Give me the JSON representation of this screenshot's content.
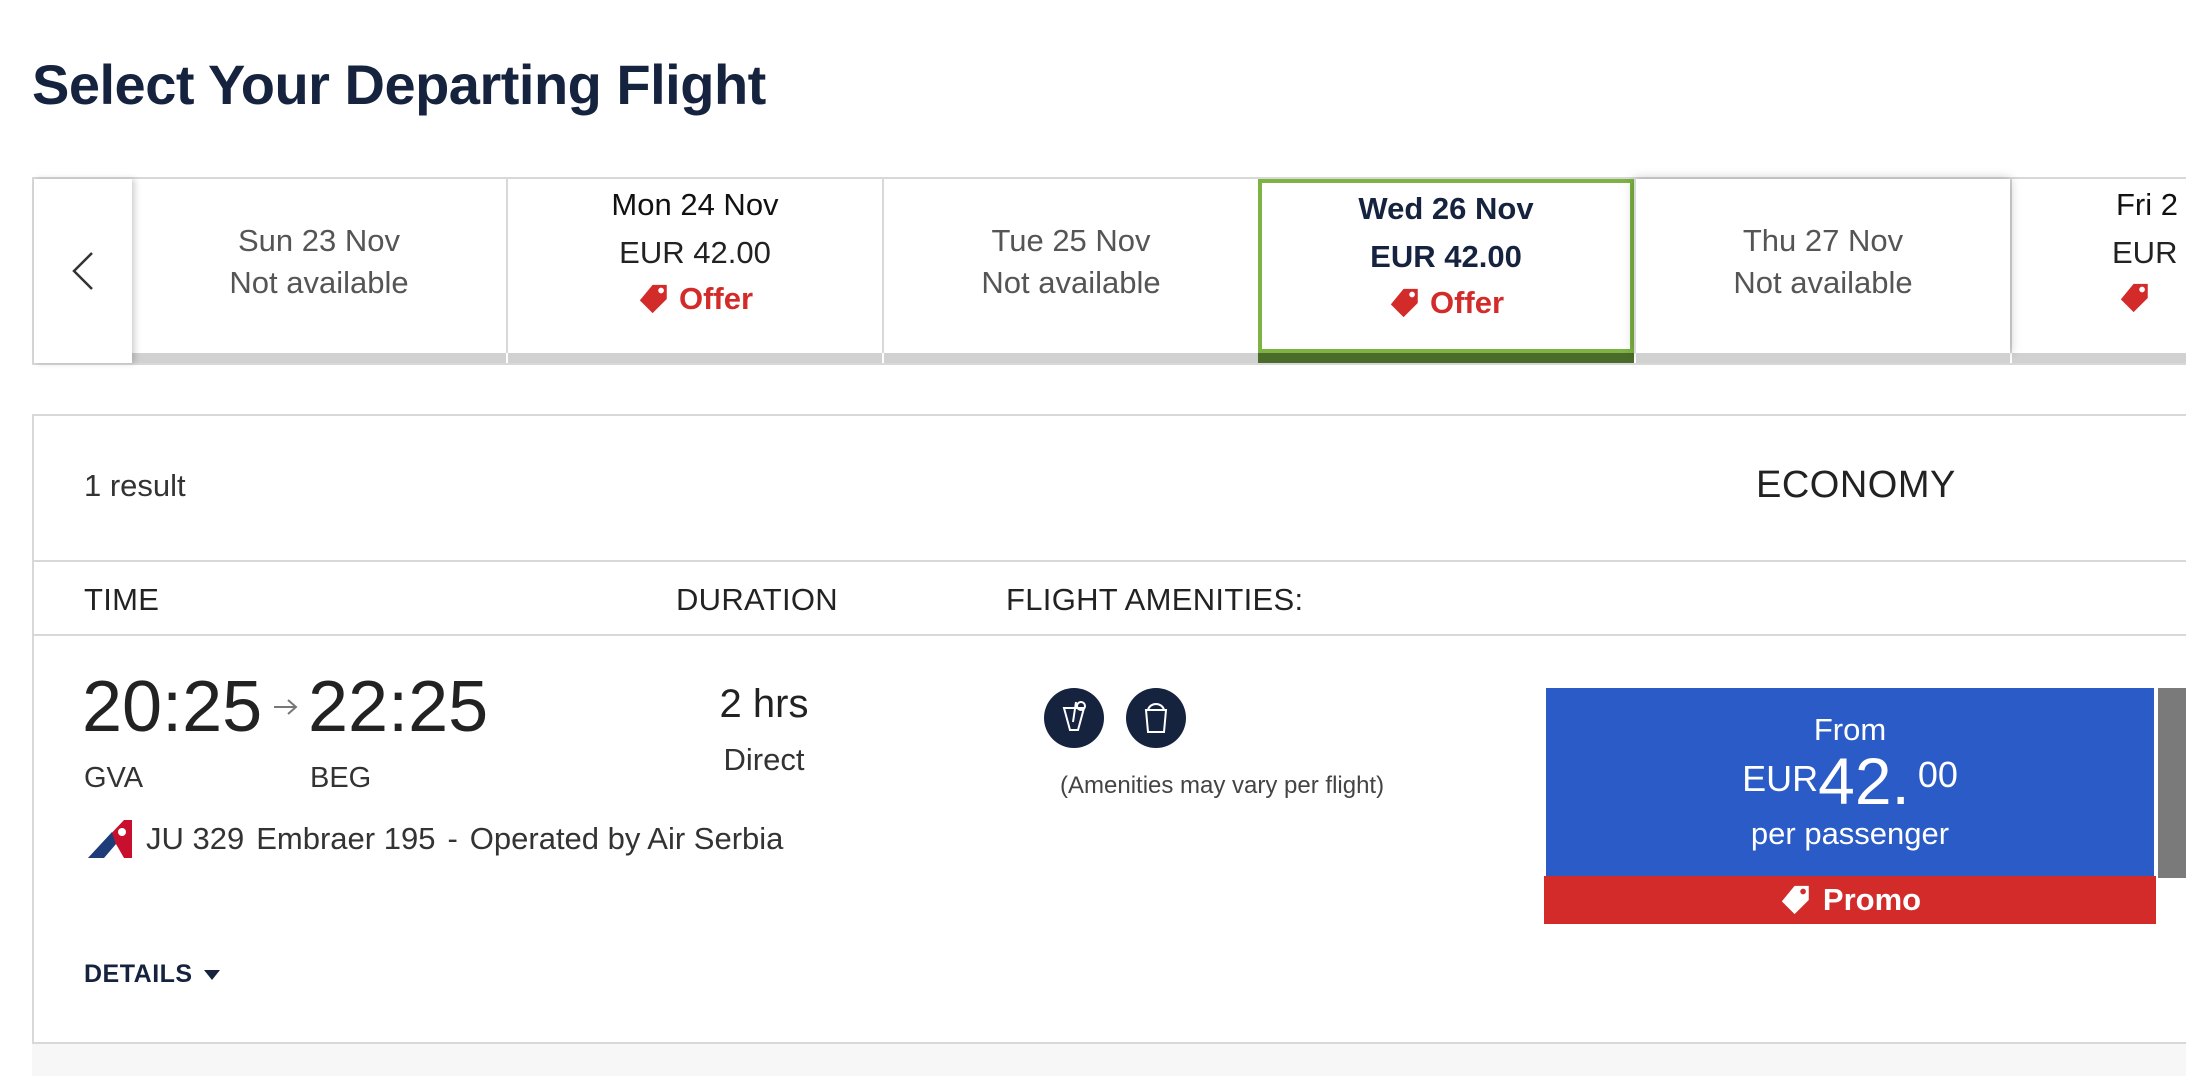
{
  "page": {
    "title": "Select Your Departing Flight"
  },
  "date_strip": {
    "dates": [
      {
        "day": "Sun 23 Nov",
        "status": "Not available"
      },
      {
        "day": "Mon 24 Nov",
        "price": "EUR 42.00",
        "badge": "Offer"
      },
      {
        "day": "Tue 25 Nov",
        "status": "Not available"
      },
      {
        "day": "Wed 26 Nov",
        "price": "EUR 42.00",
        "badge": "Offer",
        "selected": true
      },
      {
        "day": "Thu 27 Nov",
        "status": "Not available"
      },
      {
        "day": "Fri 2",
        "price": "EUR",
        "badge": ""
      }
    ]
  },
  "results": {
    "count_label": "1 result",
    "cabin": "ECONOMY",
    "columns": {
      "time": "TIME",
      "duration": "DURATION",
      "amenities": "FLIGHT AMENITIES:"
    },
    "flight": {
      "depart_time": "20:25",
      "arrive_time": "22:25",
      "origin": "GVA",
      "destination": "BEG",
      "flight_number": "JU 329",
      "aircraft": "Embraer 195",
      "separator": "-",
      "operator": "Operated by Air Serbia",
      "duration": "2 hrs",
      "stops": "Direct",
      "amenities": [
        "drink-icon",
        "snack-icon"
      ],
      "amenities_note": "(Amenities may vary per flight)",
      "price": {
        "from": "From",
        "currency": "EUR",
        "integer": "42.",
        "decimal": "00",
        "per": "per passenger",
        "promo": "Promo"
      }
    },
    "details_label": "DETAILS"
  },
  "colors": {
    "navy": "#15233f",
    "accent_blue": "#2a5bc6",
    "promo_red": "#d32a2a",
    "selected_green": "#7cb342"
  }
}
